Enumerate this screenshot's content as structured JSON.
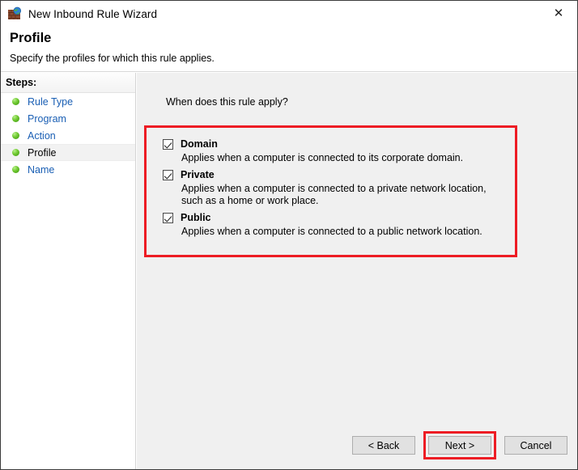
{
  "window": {
    "title": "New Inbound Rule Wizard",
    "icon": "firewall-globe-icon",
    "close_label": "✕"
  },
  "header": {
    "heading": "Profile",
    "subtitle": "Specify the profiles for which this rule applies."
  },
  "sidebar": {
    "header_label": "Steps:",
    "items": [
      {
        "label": "Rule Type",
        "current": false
      },
      {
        "label": "Program",
        "current": false
      },
      {
        "label": "Action",
        "current": false
      },
      {
        "label": "Profile",
        "current": true
      },
      {
        "label": "Name",
        "current": false
      }
    ]
  },
  "main": {
    "question": "When does this rule apply?",
    "profiles": [
      {
        "name": "Domain",
        "checked": true,
        "description": "Applies when a computer is connected to its corporate domain."
      },
      {
        "name": "Private",
        "checked": true,
        "description": "Applies when a computer is connected to a private network location, such as a home or work place."
      },
      {
        "name": "Public",
        "checked": true,
        "description": "Applies when a computer is connected to a public network location."
      }
    ]
  },
  "footer": {
    "back_label": "< Back",
    "next_label": "Next >",
    "cancel_label": "Cancel"
  },
  "annotations": {
    "highlight_color": "#ed1c24",
    "link_color": "#1a5fb4"
  }
}
